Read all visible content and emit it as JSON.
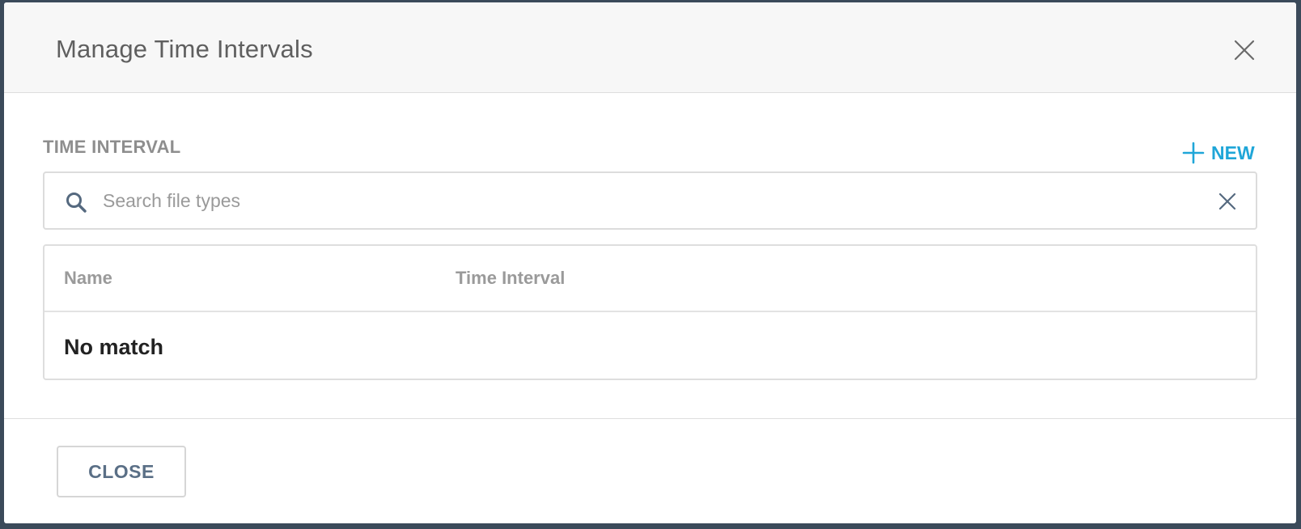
{
  "dialog": {
    "title": "Manage Time Intervals",
    "close_icon": "close-icon"
  },
  "section": {
    "label": "TIME INTERVAL",
    "new_button": {
      "icon": "plus-icon",
      "label": "NEW"
    }
  },
  "search": {
    "icon": "search-icon",
    "value": "",
    "placeholder": "Search file types",
    "clear_icon": "clear-icon"
  },
  "table": {
    "columns": [
      "Name",
      "Time Interval"
    ],
    "empty_message": "No match"
  },
  "footer": {
    "close_label": "CLOSE"
  },
  "colors": {
    "accent": "#1fa6d8",
    "header_bg": "#f7f7f7",
    "title_text": "#5f5f5f",
    "muted_text": "#9a9a9a",
    "button_text": "#5a6f86",
    "backdrop": "#3b4a5a"
  }
}
